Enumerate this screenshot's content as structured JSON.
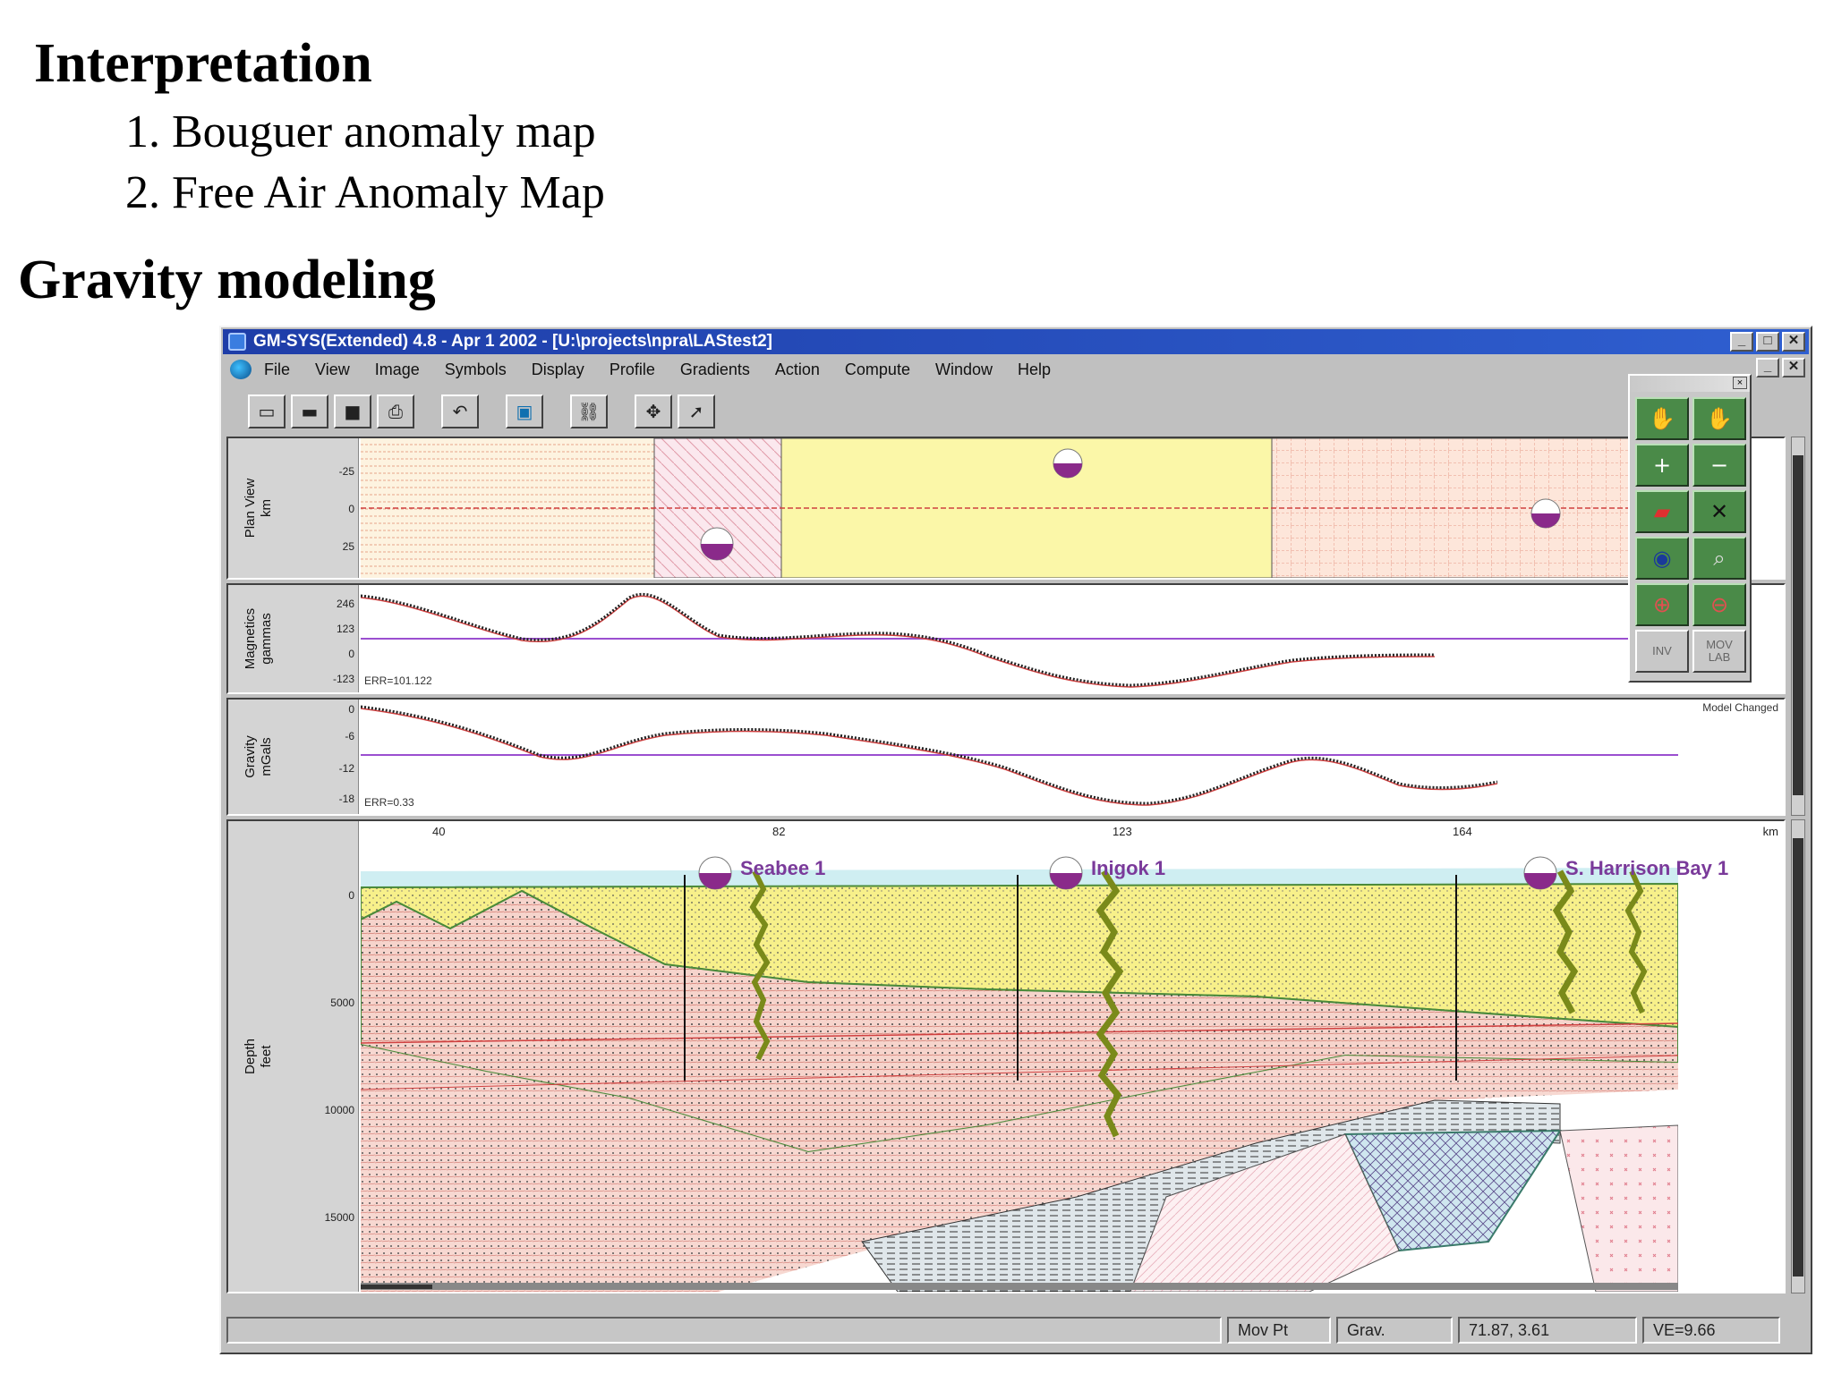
{
  "slide": {
    "heading_interpretation": "Interpretation",
    "items": [
      "1. Bouguer anomaly map",
      "2. Free Air Anomaly Map"
    ],
    "heading_modeling": "Gravity modeling"
  },
  "window": {
    "title": "GM-SYS(Extended) 4.8 - Apr 1 2002 - [U:\\projects\\npra\\LAStest2]",
    "controls": [
      "_",
      "□",
      "✕"
    ],
    "mdi_controls": [
      "_",
      "✕"
    ]
  },
  "menu": [
    "File",
    "View",
    "Image",
    "Symbols",
    "Display",
    "Profile",
    "Gradients",
    "Action",
    "Compute",
    "Window",
    "Help"
  ],
  "toolbar": [
    {
      "icon": "new-file-icon",
      "glyph": "▭"
    },
    {
      "icon": "open-file-icon",
      "glyph": "▬"
    },
    {
      "icon": "save-icon",
      "glyph": "■"
    },
    {
      "icon": "print-icon",
      "glyph": "⎙"
    },
    {
      "icon": "undo-icon",
      "glyph": "↶"
    },
    {
      "icon": "disk-icon",
      "glyph": "▣"
    },
    {
      "icon": "link-icon",
      "glyph": "⛓"
    },
    {
      "icon": "move-icon",
      "glyph": "✥"
    },
    {
      "icon": "pointer-icon",
      "glyph": "➚"
    }
  ],
  "panels": {
    "plan": {
      "label_line1": "Plan View",
      "label_line2": "km",
      "ticks": [
        "-25",
        "0",
        "25"
      ]
    },
    "magnetics": {
      "label_line1": "Magnetics",
      "label_line2": "gammas",
      "ticks": [
        "246",
        "123",
        "0",
        "-123"
      ],
      "error": "ERR=101.122"
    },
    "gravity": {
      "label_line1": "Gravity",
      "label_line2": "mGals",
      "ticks": [
        "0",
        "-6",
        "-12",
        "-18"
      ],
      "error": "ERR=0.33",
      "note": "Model Changed"
    },
    "depth": {
      "label_line1": "Depth",
      "label_line2": "feet",
      "ticks": [
        "0",
        "5000",
        "10000",
        "15000"
      ],
      "xticks": [
        "40",
        "82",
        "123",
        "164"
      ],
      "xunit": "km"
    }
  },
  "wells": [
    "Seabee 1",
    "Inigok 1",
    "S. Harrison Bay 1"
  ],
  "palette": {
    "title": "",
    "buttons": [
      {
        "icon": "hand-icon",
        "glyph": "✋"
      },
      {
        "icon": "hand-red-icon",
        "glyph": "✋"
      },
      {
        "icon": "add-point-icon",
        "glyph": "+"
      },
      {
        "icon": "remove-point-icon",
        "glyph": "−"
      },
      {
        "icon": "fill-bucket-icon",
        "glyph": "▰"
      },
      {
        "icon": "delete-icon",
        "glyph": "✕"
      },
      {
        "icon": "view-eye-icon",
        "glyph": "◉"
      },
      {
        "icon": "zoom-icon",
        "glyph": "⌕"
      },
      {
        "icon": "zoom-in-icon",
        "glyph": "⊕"
      },
      {
        "icon": "zoom-out-icon",
        "glyph": "⊖"
      }
    ],
    "text_buttons": [
      "INV",
      "MOV LAB"
    ]
  },
  "status": {
    "mode": "Mov Pt",
    "field": "Grav.",
    "coords": "71.87, 3.61",
    "ve": "VE=9.66"
  },
  "colors": {
    "titlebar": "#1e3da8",
    "observed": "#222222",
    "calculated": "#d04040",
    "baseline": "#9b4fd0",
    "well_symbol": "#8a2a8a",
    "sand_yellow": "#f7f08a",
    "plan_yellow": "#fbf7a8"
  }
}
